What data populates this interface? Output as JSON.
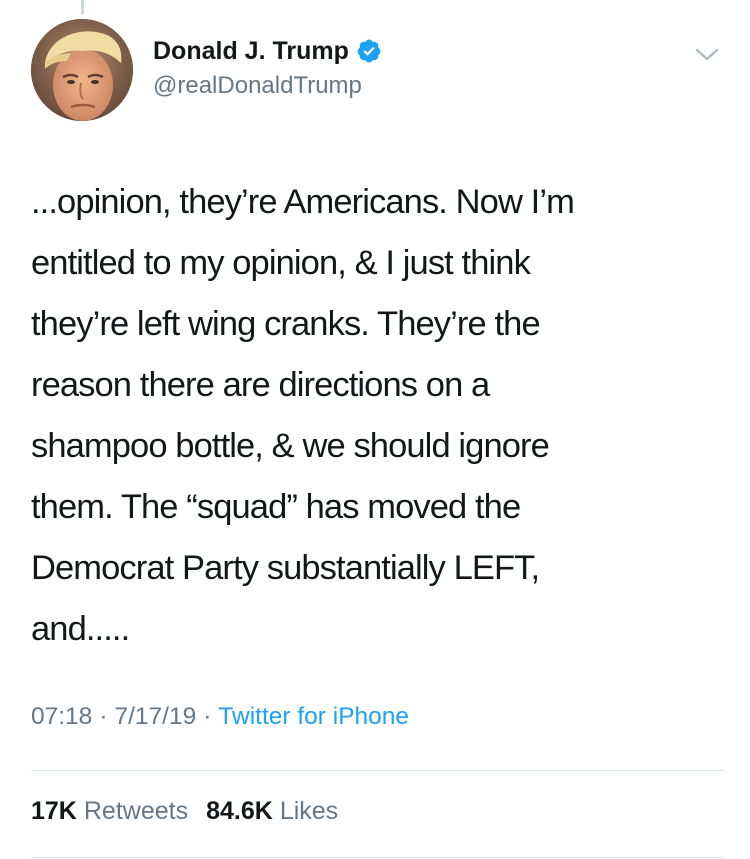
{
  "tweet": {
    "author": {
      "display_name": "Donald J. Trump",
      "handle": "@realDonaldTrump",
      "verified": true,
      "verified_icon": "verified-badge-icon",
      "verified_color": "#1da1f2"
    },
    "menu_icon": "chevron-down-icon",
    "text": "...opinion, they’re Americans. Now I’m\nentitled to my opinion, & I just think\nthey’re left wing cranks. They’re the\nreason there are directions on a\nshampoo bottle, & we should ignore\nthem. The “squad” has moved the\nDemocrat Party substantially LEFT,\nand.....",
    "time": "07:18",
    "separator": "·",
    "date": "7/17/19",
    "source": "Twitter for iPhone",
    "stats": {
      "retweets_count": "17K",
      "retweets_label": "Retweets",
      "likes_count": "84.6K",
      "likes_label": "Likes"
    }
  },
  "colors": {
    "text": "#14171a",
    "secondary": "#657786",
    "link": "#1da1f2",
    "divider": "#e1e8ed"
  }
}
